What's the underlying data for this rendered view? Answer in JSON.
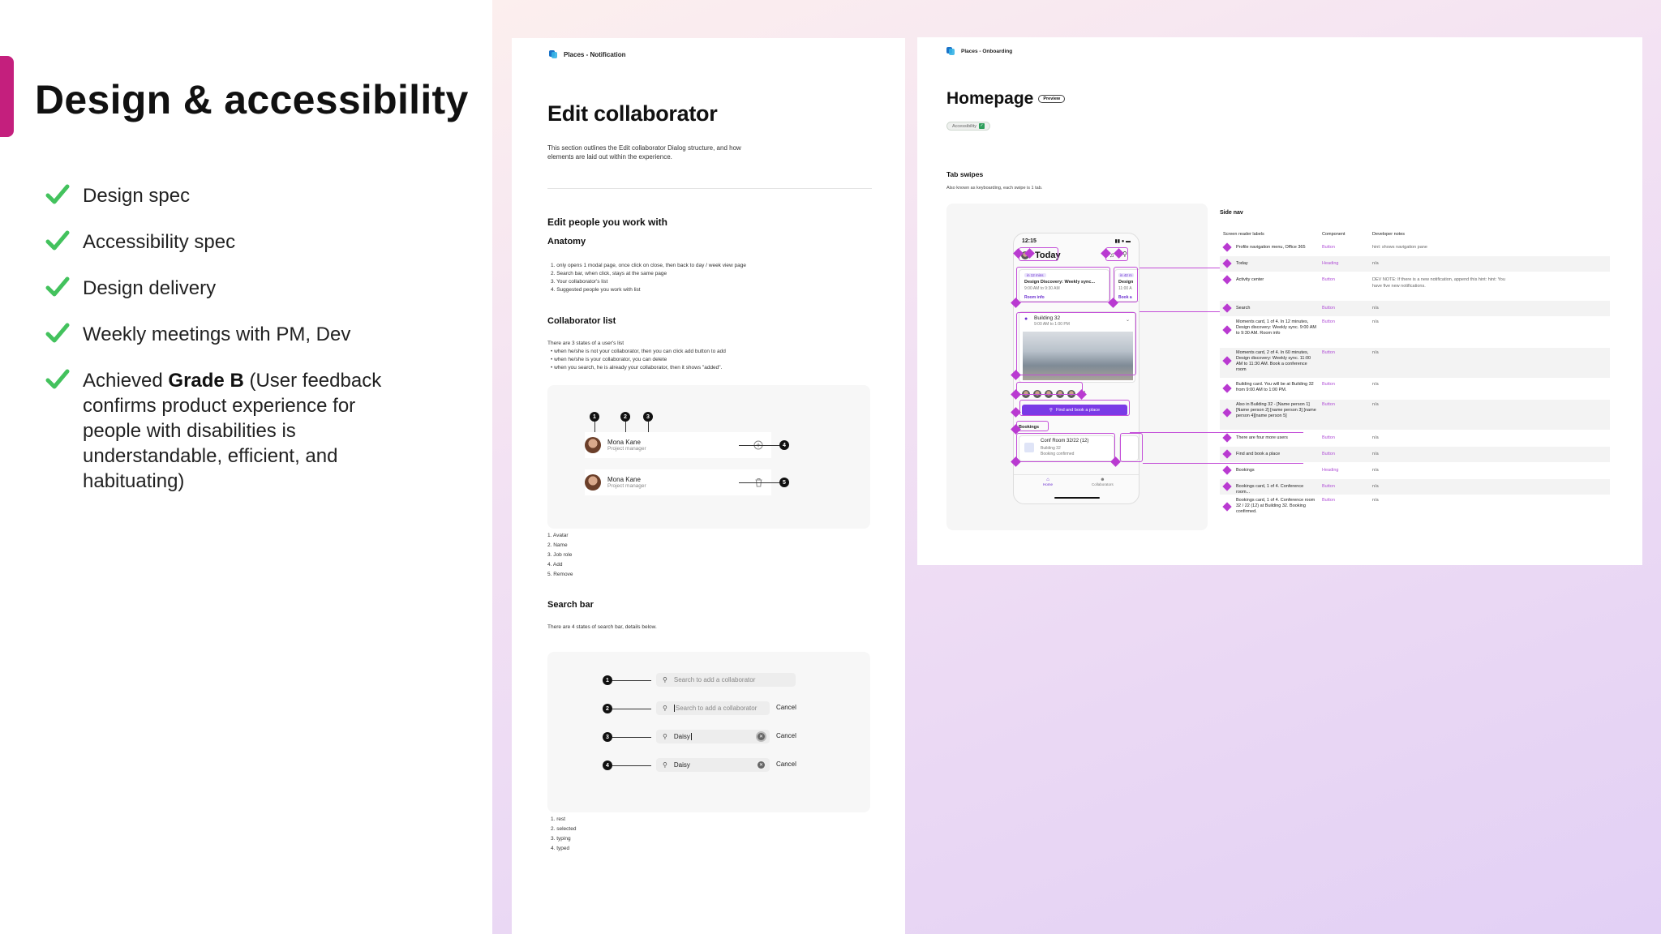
{
  "slide": {
    "title": "Design & accessibility",
    "bullets": [
      {
        "text": "Design spec"
      },
      {
        "text": "Accessibility spec"
      },
      {
        "text": "Design delivery"
      },
      {
        "text": "Weekly meetings with PM, Dev"
      },
      {
        "text_before": "Achieved ",
        "bold": "Grade B",
        "text_after": " (User feedback confirms product experience for people with disabilities is understandable, efficient, and habituating)"
      }
    ],
    "colors": {
      "accent": "#c41f7d",
      "check": "#43c25d"
    }
  },
  "doc1": {
    "header": "Places - Notification",
    "title": "Edit collaborator",
    "intro": "This section outlines the Edit collaborator Dialog structure, and how elements are laid out within the experience.",
    "section_title": "Edit people you work with",
    "anatomy_title": "Anatomy",
    "anatomy_items": [
      "1. only opens 1 modal page, once click on close, then back to day / week view page",
      "2. Search bar, when click, stays at the same page",
      "3. Your collaborator's list",
      "4. Suggested people you work with list"
    ],
    "list_title": "Collaborator list",
    "list_intro": "There are 3 states of a user's list",
    "list_items": [
      "• when he/she is not your collaborator, then you can click add button to add",
      "• when he/she is your collaborator, you can delete",
      "• when you search, he is already your collaborator, then it shows \"added\"."
    ],
    "collaborators": [
      {
        "name": "Mona Kane",
        "role": "Project manager"
      },
      {
        "name": "Mona Kane",
        "role": "Project manager"
      }
    ],
    "markers": [
      "1",
      "2",
      "3",
      "4",
      "5"
    ],
    "parts": [
      "1. Avatar",
      "2. Name",
      "3. Job role",
      "4. Add",
      "5. Remove"
    ],
    "search_title": "Search bar",
    "search_intro": "There are 4 states of search bar, details below.",
    "search_states": [
      {
        "marker": "1",
        "text": "Search to add a collaborator",
        "cancel": ""
      },
      {
        "marker": "2",
        "text": "Search to add a collaborator",
        "cancel": "Cancel"
      },
      {
        "marker": "3",
        "text": "Daisy",
        "cancel": "Cancel"
      },
      {
        "marker": "4",
        "text": "Daisy",
        "cancel": "Cancel"
      }
    ],
    "state_names": [
      "1. rest",
      "2. selected",
      "3. typing",
      "4. typed"
    ]
  },
  "doc2": {
    "header": "Places - Onboarding",
    "title": "Homepage",
    "pill": "Preview",
    "badge": "Accessibility",
    "tab_title": "Tab swipes",
    "tab_desc": "Also known as keyboarding, each swipe is 1 tab.",
    "phone": {
      "time": "12:15",
      "title": "Today",
      "card1_tag": "in 12 mins",
      "card1_title": "Design Discovery: Weekly sync...",
      "card1_time": "9:00 AM to 9:30 AM",
      "card1_link": "Room info",
      "card1b_tag": "in 42 m",
      "card1b_title": "Design",
      "card1b_time": "11:00 A",
      "card1b_link": "Book a",
      "building": "Building 32",
      "building_time": "9:00 AM to 1:00 PM",
      "avatar_more": "+4",
      "cta": "Find and book a place",
      "bookings": "Bookings",
      "room": "Conf Room 32/22 (12)",
      "room_sub": "Building 32",
      "room_status": "Booking confirmed",
      "nav_home": "Home",
      "nav_collab": "Collaborators"
    },
    "side_nav_title": "Side nav",
    "table_headers": [
      "Screen reader labels",
      "Component",
      "Developer notes"
    ],
    "table_rows": [
      {
        "label": "Profile navigation menu, Office 365",
        "component": "Button",
        "notes": "hint: shows navigation pane"
      },
      {
        "label": "Today",
        "component": "Heading",
        "notes": "n/a"
      },
      {
        "label": "Activity center",
        "component": "Button",
        "notes": "DEV NOTE: If there is a new notification, append this hint: hint: You have five new notifications."
      },
      {
        "label": "Search",
        "component": "Button",
        "notes": "n/a"
      },
      {
        "label": "Moments card, 1 of 4. In 12 minutes, Design discovery: Weekly sync. 9:00 AM to 9:30 AM. Room info",
        "component": "Button",
        "notes": "n/a"
      },
      {
        "label": "Moments card, 2 of 4. In 60 minutes, Design discovery: Weekly sync. 11:00 AM to 11:30 AM. Book a conference room",
        "component": "Button",
        "notes": "n/a"
      },
      {
        "label": "Building card. You will be at Building 32 from 9:00 AM to 1:00 PM.",
        "component": "Button",
        "notes": "n/a"
      },
      {
        "label": "Also in Building 32 - [Name person 1] [Name person 2] [name person 3] [name person 4][name person 5]",
        "component": "Button",
        "notes": "n/a"
      },
      {
        "label": "There are four more users",
        "component": "Button",
        "notes": "n/a"
      },
      {
        "label": "Find and book a place",
        "component": "Button",
        "notes": "n/a"
      },
      {
        "label": "Bookings",
        "component": "Heading",
        "notes": "n/a"
      },
      {
        "label": "Bookings card, 1 of 4. Conference room...",
        "component": "Button",
        "notes": "n/a"
      },
      {
        "label": "Bookings card, 1 of 4. Conference room 32 / 22 (12) at Building 32. Booking confirmed.",
        "component": "Button",
        "notes": "n/a"
      }
    ],
    "colors": {
      "annotation": "#c34ed8",
      "cta": "#7a3ae6"
    }
  }
}
